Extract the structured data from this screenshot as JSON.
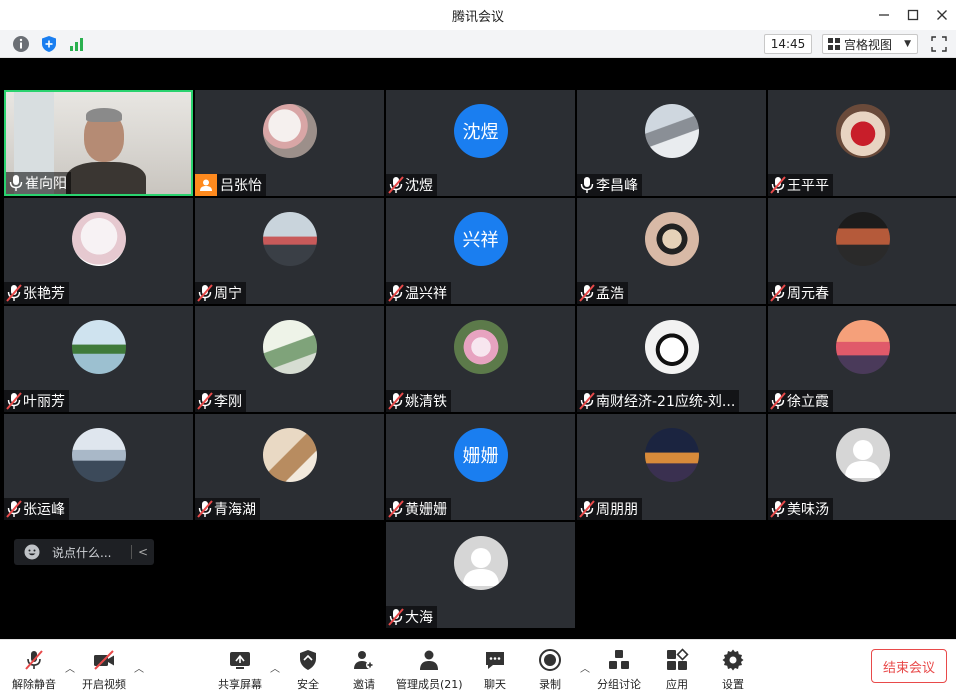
{
  "window": {
    "title": "腾讯会议"
  },
  "status": {
    "time": "14:45",
    "view_mode": "宫格视图"
  },
  "chat": {
    "placeholder": "说点什么..."
  },
  "participants": [
    {
      "name": "崔向阳",
      "mic": "on",
      "avatar": "video"
    },
    {
      "name": "吕张怡",
      "mic": "host-icon",
      "avatar": "photo"
    },
    {
      "name": "沈煜",
      "mic": "muted",
      "avatar": "text",
      "avatar_text": "沈煜"
    },
    {
      "name": "李昌峰",
      "mic": "on",
      "avatar": "photo"
    },
    {
      "name": "王平平",
      "mic": "muted",
      "avatar": "photo"
    },
    {
      "name": "张艳芳",
      "mic": "muted",
      "avatar": "photo"
    },
    {
      "name": "周宁",
      "mic": "muted",
      "avatar": "photo"
    },
    {
      "name": "温兴祥",
      "mic": "muted",
      "avatar": "text",
      "avatar_text": "兴祥"
    },
    {
      "name": "孟浩",
      "mic": "muted",
      "avatar": "photo"
    },
    {
      "name": "周元春",
      "mic": "muted",
      "avatar": "photo"
    },
    {
      "name": "叶丽芳",
      "mic": "muted",
      "avatar": "photo"
    },
    {
      "name": "李刚",
      "mic": "muted",
      "avatar": "photo"
    },
    {
      "name": "姚清铁",
      "mic": "muted",
      "avatar": "photo"
    },
    {
      "name": "南财经济-21应统-刘...",
      "mic": "muted",
      "avatar": "photo"
    },
    {
      "name": "徐立霞",
      "mic": "muted",
      "avatar": "photo"
    },
    {
      "name": "张运峰",
      "mic": "muted",
      "avatar": "photo"
    },
    {
      "name": "青海湖",
      "mic": "muted",
      "avatar": "photo"
    },
    {
      "name": "黄姗姗",
      "mic": "muted",
      "avatar": "text",
      "avatar_text": "姗姗"
    },
    {
      "name": "周朋朋",
      "mic": "muted",
      "avatar": "photo"
    },
    {
      "name": "美味汤",
      "mic": "muted",
      "avatar": "default"
    },
    {
      "name": "大海",
      "mic": "muted",
      "avatar": "default"
    }
  ],
  "toolbar": {
    "unmute": "解除静音",
    "start_video": "开启视频",
    "share_screen": "共享屏幕",
    "security": "安全",
    "invite": "邀请",
    "manage_members": "管理成员(21)",
    "chat": "聊天",
    "record": "录制",
    "breakout": "分组讨论",
    "apps": "应用",
    "settings": "设置",
    "end_meeting": "结束会议"
  },
  "colors": {
    "accent": "#1a7ef0",
    "danger": "#e84a4a",
    "active_speaker": "#2ad26f",
    "tile_bg": "#2b2e33"
  }
}
